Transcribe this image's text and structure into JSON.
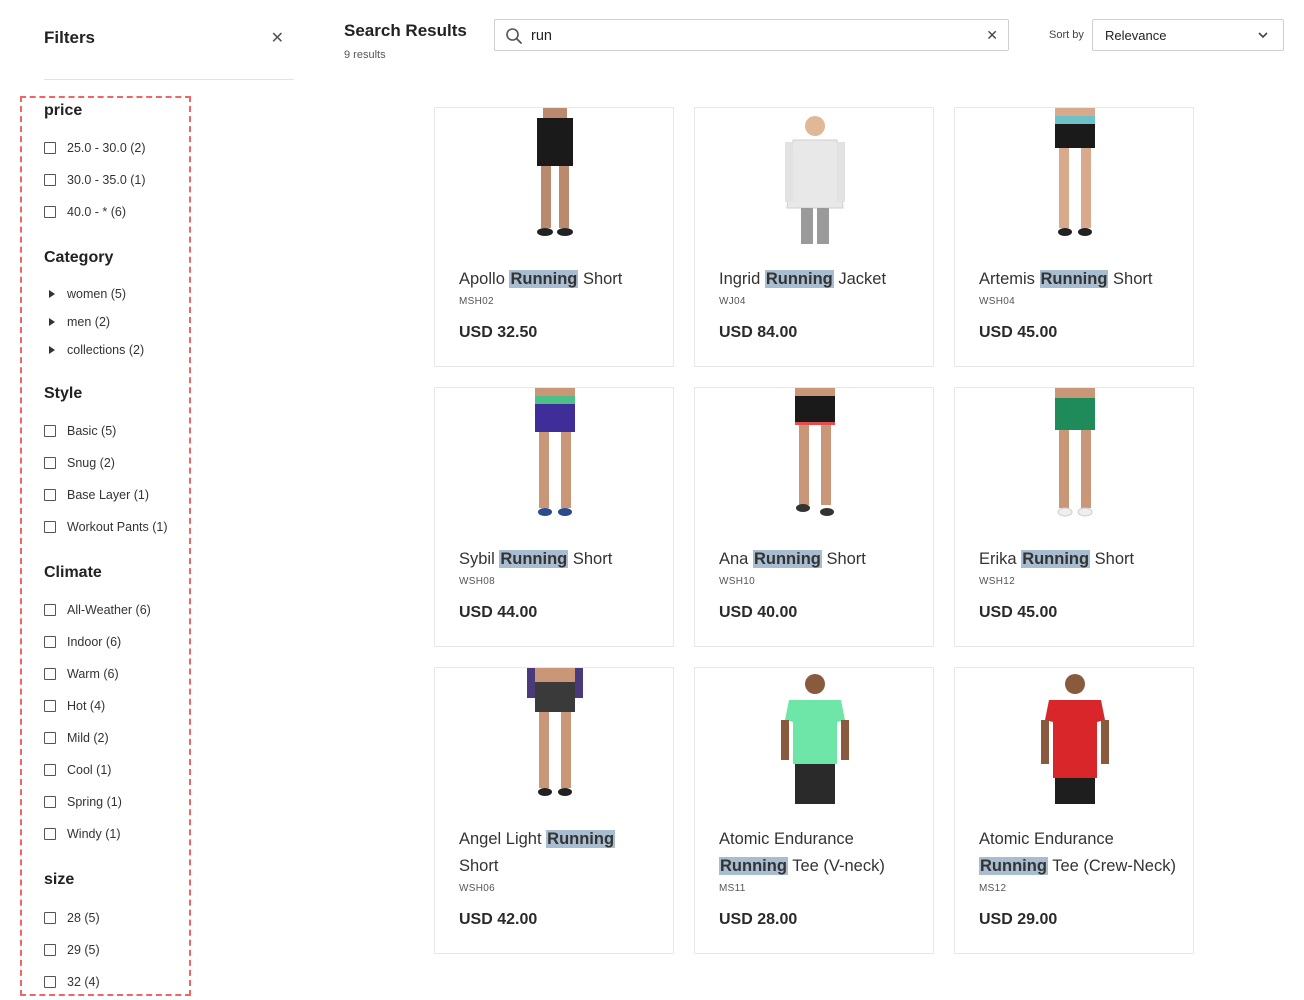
{
  "sidebar": {
    "title": "Filters",
    "close_icon": "close-icon",
    "facets": {
      "price": {
        "title": "price",
        "options": [
          "25.0 - 30.0 (2)",
          "30.0 - 35.0 (1)",
          "40.0 - * (6)"
        ]
      },
      "category": {
        "title": "Category",
        "options": [
          "women (5)",
          "men (2)",
          "collections (2)"
        ]
      },
      "style": {
        "title": "Style",
        "options": [
          "Basic (5)",
          "Snug (2)",
          "Base Layer (1)",
          "Workout Pants (1)"
        ]
      },
      "climate": {
        "title": "Climate",
        "options": [
          "All-Weather (6)",
          "Indoor (6)",
          "Warm (6)",
          "Hot (4)",
          "Mild (2)",
          "Cool (1)",
          "Spring (1)",
          "Windy (1)"
        ]
      },
      "size": {
        "title": "size",
        "options": [
          "28 (5)",
          "29 (5)",
          "32 (4)"
        ]
      }
    }
  },
  "header": {
    "title": "Search Results",
    "count": "9 results"
  },
  "search": {
    "value": "run",
    "icon": "search-icon",
    "clear_icon": "close-icon"
  },
  "sort": {
    "label": "Sort by",
    "value": "Relevance",
    "icon": "chevron-down-icon"
  },
  "highlight_color": "#a9bdd0",
  "products": [
    {
      "name_pre": "Apollo ",
      "name_hl": "Running",
      "name_post": " Short",
      "sku": "MSH02",
      "price": "USD 32.50",
      "figure": "shorts-black"
    },
    {
      "name_pre": "Ingrid ",
      "name_hl": "Running",
      "name_post": " Jacket",
      "sku": "WJ04",
      "price": "USD 84.00",
      "figure": "jacket-white"
    },
    {
      "name_pre": "Artemis ",
      "name_hl": "Running",
      "name_post": " Short",
      "sku": "WSH04",
      "price": "USD 45.00",
      "figure": "shorts-black-teal"
    },
    {
      "name_pre": "Sybil ",
      "name_hl": "Running",
      "name_post": " Short",
      "sku": "WSH08",
      "price": "USD 44.00",
      "figure": "shorts-purple"
    },
    {
      "name_pre": "Ana ",
      "name_hl": "Running",
      "name_post": " Short",
      "sku": "WSH10",
      "price": "USD 40.00",
      "figure": "shorts-black-red"
    },
    {
      "name_pre": "Erika ",
      "name_hl": "Running",
      "name_post": " Short",
      "sku": "WSH12",
      "price": "USD 45.00",
      "figure": "shorts-green"
    },
    {
      "name_pre": "Angel Light ",
      "name_hl": "Running",
      "name_post": " Short",
      "sku": "WSH06",
      "price": "USD 42.00",
      "figure": "shorts-gray"
    },
    {
      "name_pre": "Atomic Endurance ",
      "name_hl": "Running",
      "name_post": " Tee (V-neck)",
      "sku": "MS11",
      "price": "USD 28.00",
      "figure": "tee-mint"
    },
    {
      "name_pre": "Atomic Endurance ",
      "name_hl": "Running",
      "name_post": " Tee (Crew-Neck)",
      "sku": "MS12",
      "price": "USD 29.00",
      "figure": "tee-red"
    }
  ]
}
